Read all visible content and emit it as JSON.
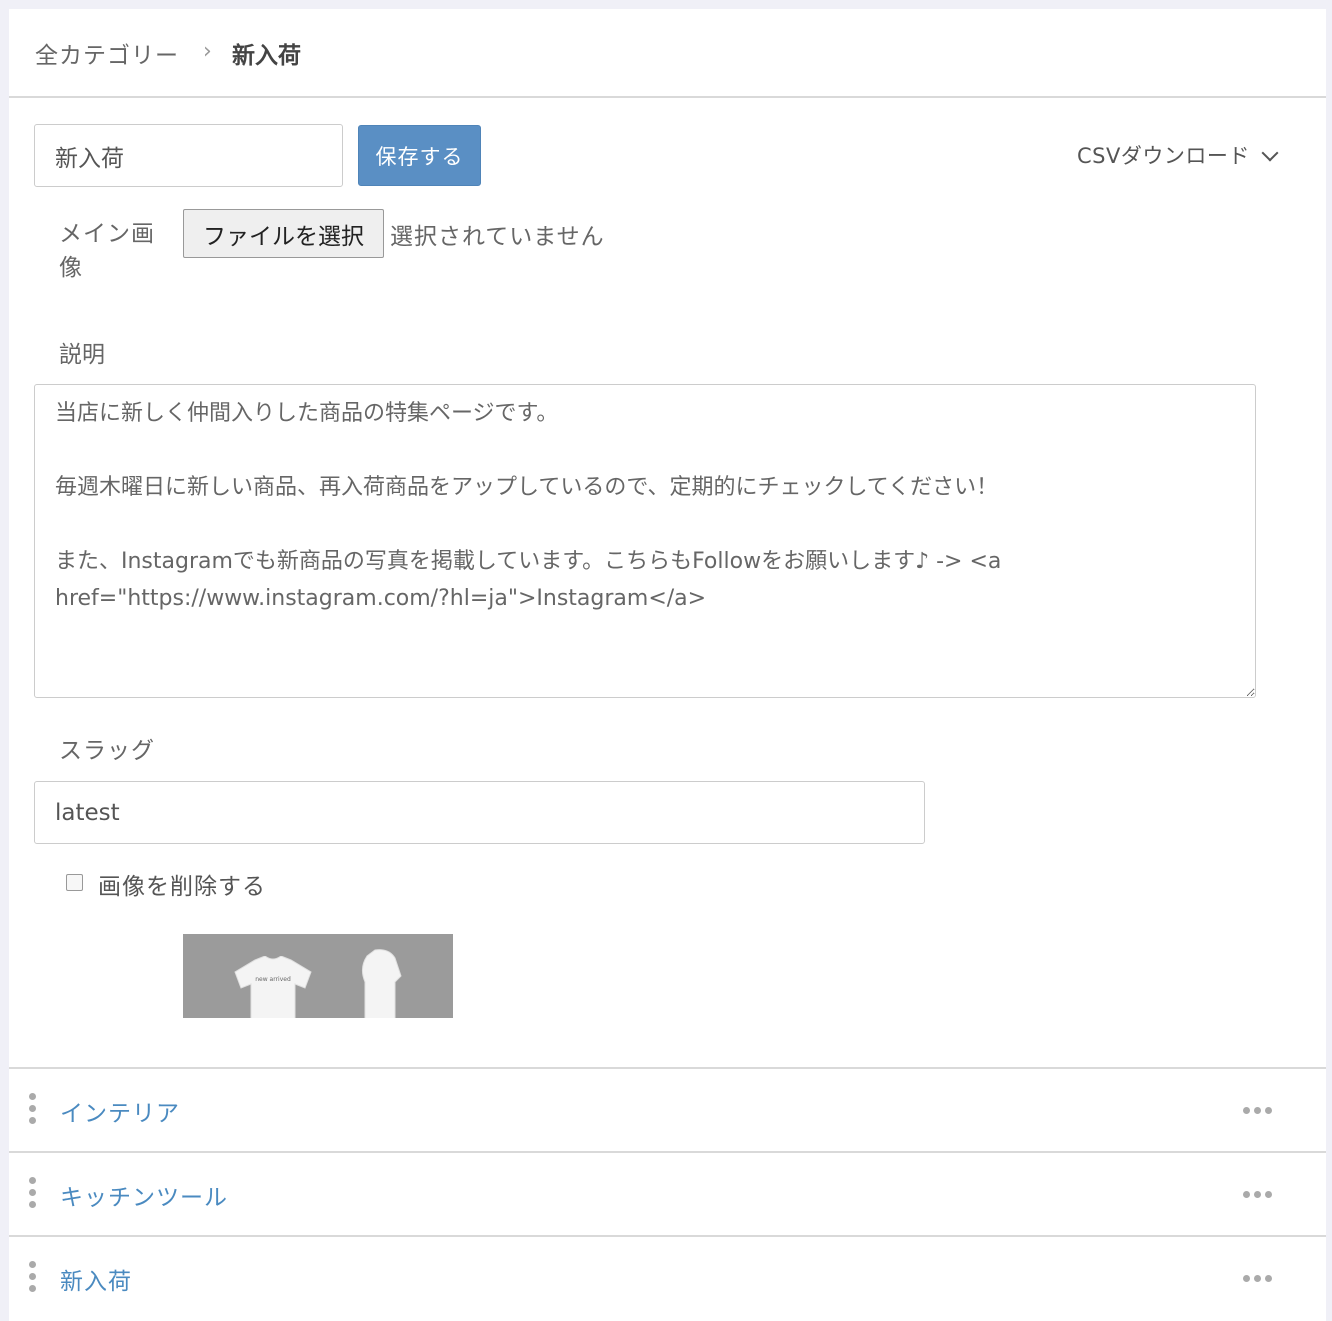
{
  "breadcrumb": {
    "root": "全カテゴリー",
    "separator": "›",
    "current": "新入荷"
  },
  "form": {
    "name_value": "新入荷",
    "save_label": "保存する",
    "csv_label": "CSVダウンロード",
    "main_image_label": "メイン画像",
    "file_button_label": "ファイルを選択",
    "file_status": "選択されていません",
    "description_label": "説明",
    "description_value": "当店に新しく仲間入りした商品の特集ページです。\n\n毎週木曜日に新しい商品、再入荷商品をアップしているので、定期的にチェックしてください！\n\nまた、Instagramでも新商品の写真を掲載しています。こちらもFollowをお願いします♪ -> <a href=\"https://www.instagram.com/?hl=ja\">Instagram</a>",
    "slug_label": "スラッグ",
    "slug_value": "latest",
    "delete_image_label": "画像を削除する",
    "delete_image_checked": false,
    "thumbnail_caption": "new arrived"
  },
  "categories": [
    {
      "label": "インテリア"
    },
    {
      "label": "キッチンツール"
    },
    {
      "label": "新入荷"
    }
  ],
  "colors": {
    "accent": "#5a8fc4",
    "link": "#4a8ac0",
    "background": "#f0f0f7"
  }
}
